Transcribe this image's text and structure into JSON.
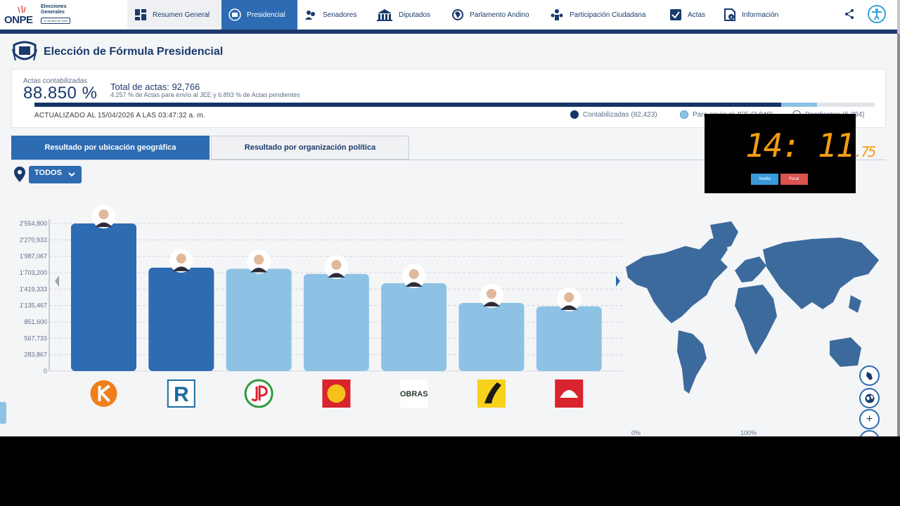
{
  "header": {
    "logo": {
      "brand": "ONPE",
      "subtitle_line1": "Elecciones",
      "subtitle_line2": "Generales",
      "date": "12 de abril de 2026"
    },
    "nav": [
      {
        "label": "Resumen General",
        "icon": "grid-icon"
      },
      {
        "label": "Presidencial",
        "icon": "presidential-seal-icon"
      },
      {
        "label": "Senadores",
        "icon": "senate-icon"
      },
      {
        "label": "Diputados",
        "icon": "congress-building-icon"
      },
      {
        "label": "Parlamento Andino",
        "icon": "andean-parliament-icon"
      },
      {
        "label": "Participación Ciudadana",
        "icon": "people-icon"
      },
      {
        "label": "Actas",
        "icon": "checklist-icon"
      },
      {
        "label": "Información",
        "icon": "info-doc-icon"
      }
    ]
  },
  "title": "Elección de Fórmula Presidencial",
  "summary": {
    "label": "Actas contabilizadas",
    "percent": "88.850 %",
    "total": "Total de actas: 92,766",
    "detail": "4.257 % de Actas para envío al JEE y 6.893 % de Actas pendientes",
    "updated": "ACTUALIZADO AL 15/04/2026 A LAS 03:47:32 a. m.",
    "progress": {
      "contabilizadas": 0.8885,
      "jee": 0.04257
    },
    "legend": [
      {
        "label": "Contabilizadas (82,423)",
        "color": "#143566"
      },
      {
        "label": "Para envío al JEE (3,949)",
        "color": "#8dc2e4"
      },
      {
        "label": "Pendientes (6,394)",
        "color": "#ffffff"
      }
    ]
  },
  "tabs": {
    "geo": "Resultado por ubicación geográfica",
    "org": "Resultado por organización política"
  },
  "filter": {
    "value": "TODOS"
  },
  "chart_data": {
    "type": "bar",
    "categories": [
      "Fuerza Popular",
      "Renovación Popular",
      "Juntos por el Perú",
      "Partido del Buen Gobierno",
      "Obras",
      "País para Todos",
      "Primero la Gente"
    ],
    "values": [
      2554800,
      1790000,
      1770000,
      1680000,
      1520000,
      1180000,
      1120000
    ],
    "highlight": [
      true,
      true,
      false,
      false,
      false,
      false,
      false
    ],
    "yticks": [
      "2'554,800",
      "2'270,933",
      "1'987,067",
      "1'703,200",
      "1'419,333",
      "1'135,467",
      "851,600",
      "567,733",
      "283,867",
      "0"
    ],
    "ylim": [
      0,
      2554800
    ],
    "colors": {
      "highlight": "#2d6bb2",
      "normal": "#8dc2e4"
    }
  },
  "map": {
    "scale_min": "0%",
    "scale_max": "100%"
  },
  "timer": {
    "main": "14: 11",
    "fraction": ".75",
    "lap": "Vuelta",
    "stop": "Parar"
  }
}
